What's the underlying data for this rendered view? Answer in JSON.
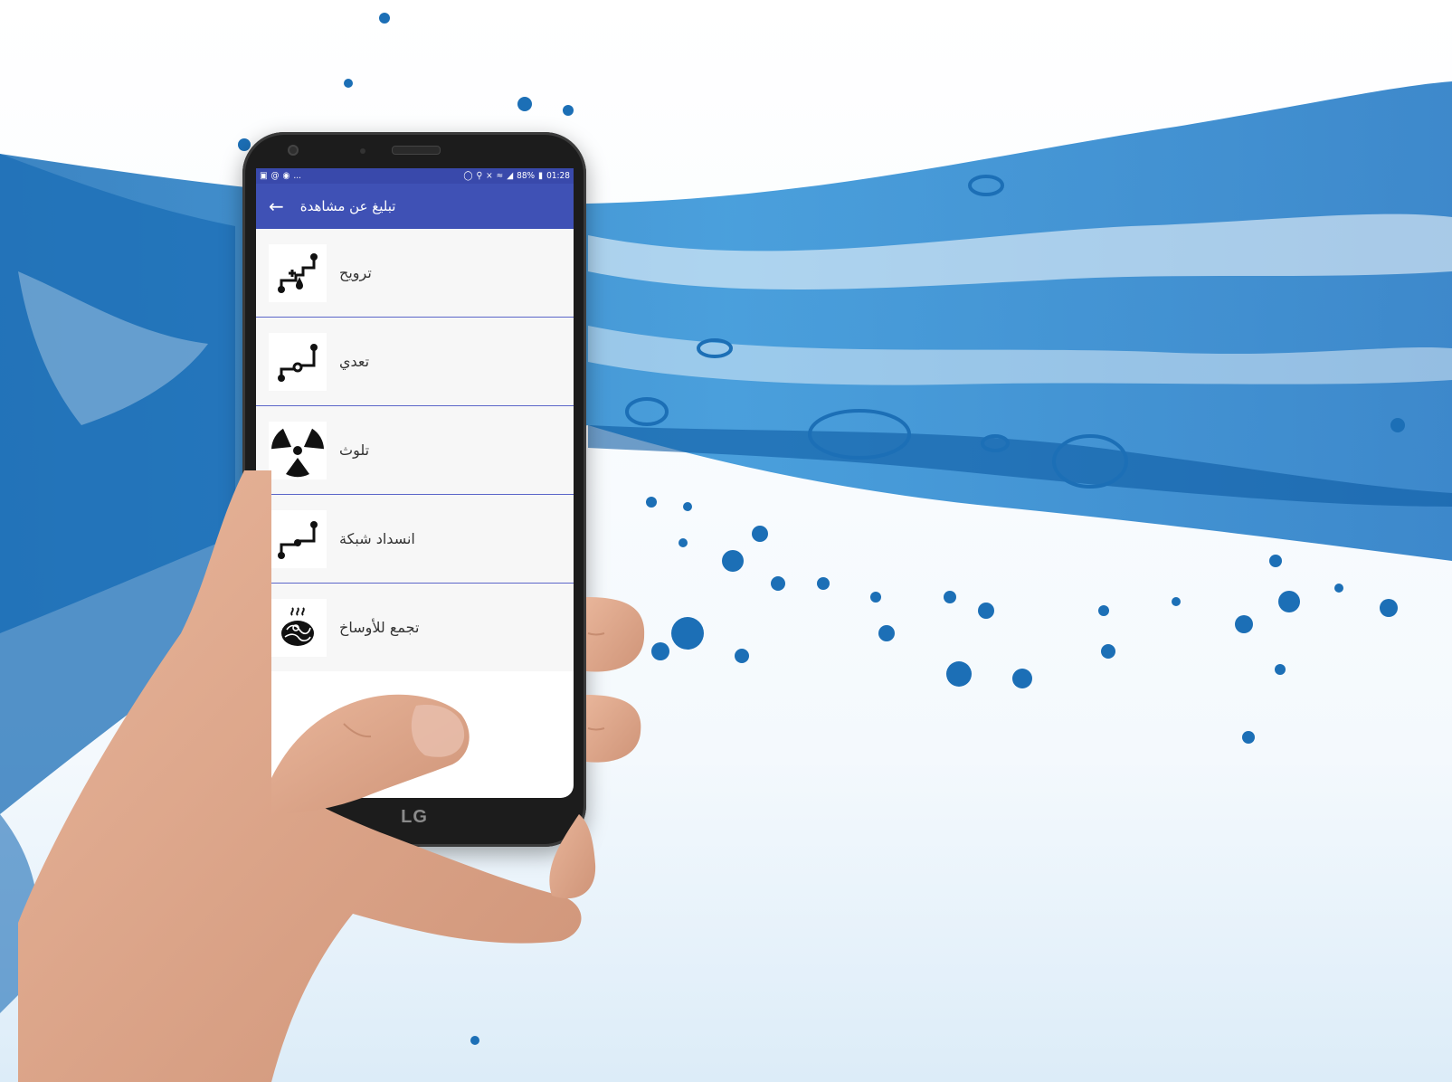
{
  "status_bar": {
    "left_icons": [
      "image-icon",
      "at-icon",
      "facebook-icon"
    ],
    "left_more": "...",
    "battery": "88%",
    "time": "01:28"
  },
  "app_bar": {
    "title": "تبليغ عن مشاهدة",
    "back_icon": "arrow-back-icon"
  },
  "items": [
    {
      "label": "ترويح",
      "icon": "leaking-pipe-icon"
    },
    {
      "label": "تعدي",
      "icon": "pipe-valve-icon"
    },
    {
      "label": "تلوث",
      "icon": "radiation-icon"
    },
    {
      "label": "انسداد شبكة",
      "icon": "pipe-network-icon"
    },
    {
      "label": "تجمع للأوساخ",
      "icon": "waste-pile-icon"
    }
  ],
  "phone": {
    "brand": "LG"
  },
  "colors": {
    "primary": "#3f51b5",
    "primary_dark": "#3949ab",
    "divider": "#5b66c9"
  }
}
